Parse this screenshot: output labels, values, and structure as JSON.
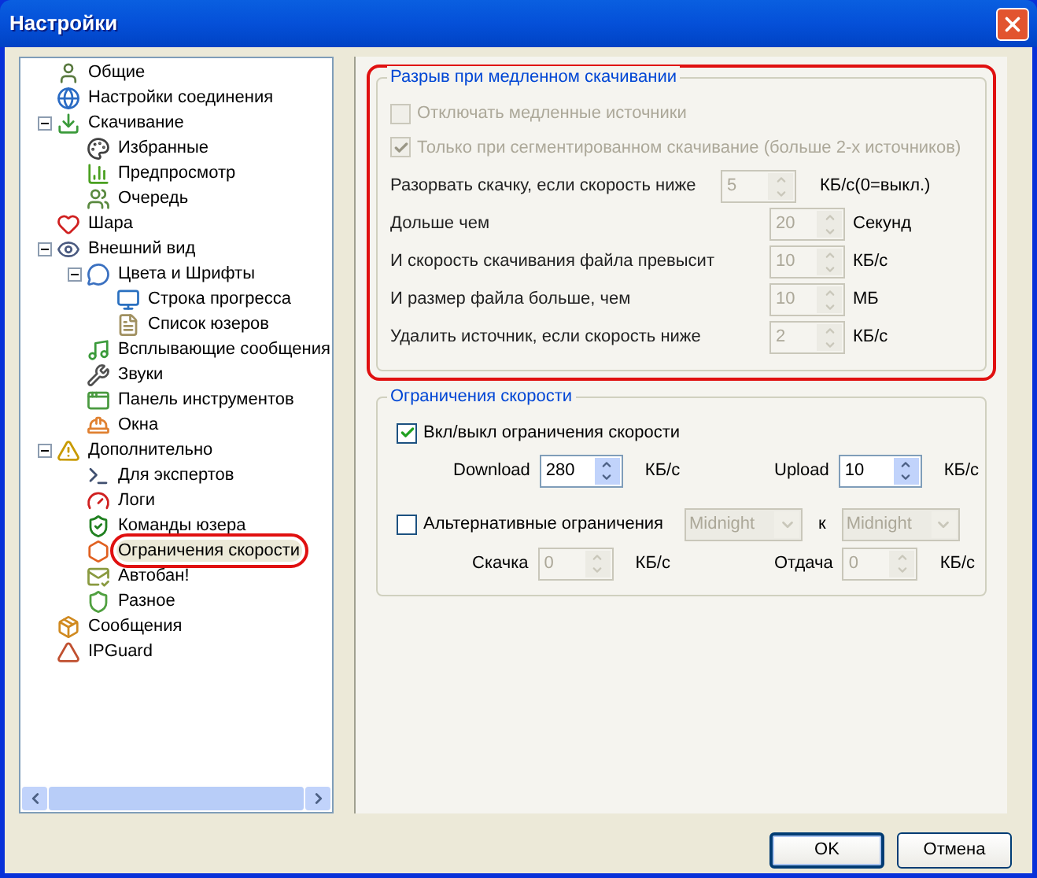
{
  "window": {
    "title": "Настройки"
  },
  "tree": {
    "items": [
      {
        "label": "Общие",
        "selected": false,
        "annotated": false
      },
      {
        "label": "Настройки соединения",
        "selected": false,
        "annotated": false
      },
      {
        "label": "Скачивание",
        "selected": false,
        "annotated": false,
        "expanded": true,
        "children": [
          {
            "label": "Избранные",
            "selected": false,
            "annotated": false
          },
          {
            "label": "Предпросмотр",
            "selected": false,
            "annotated": false
          },
          {
            "label": "Очередь",
            "selected": false,
            "annotated": false
          }
        ]
      },
      {
        "label": "Шара",
        "selected": false,
        "annotated": false
      },
      {
        "label": "Внешний вид",
        "selected": false,
        "annotated": false,
        "expanded": true,
        "children": [
          {
            "label": "Цвета и Шрифты",
            "selected": false,
            "annotated": false,
            "expanded": true,
            "children": [
              {
                "label": "Строка прогресса",
                "selected": false,
                "annotated": false
              },
              {
                "label": "Список юзеров",
                "selected": false,
                "annotated": false
              }
            ]
          },
          {
            "label": "Всплывающие сообщения",
            "selected": false,
            "annotated": false
          },
          {
            "label": "Звуки",
            "selected": false,
            "annotated": false
          },
          {
            "label": "Панель инструментов",
            "selected": false,
            "annotated": false
          },
          {
            "label": "Окна",
            "selected": false,
            "annotated": false
          }
        ]
      },
      {
        "label": "Дополнительно",
        "selected": false,
        "annotated": false,
        "expanded": true,
        "children": [
          {
            "label": "Для экспертов",
            "selected": false,
            "annotated": false
          },
          {
            "label": "Логи",
            "selected": false,
            "annotated": false
          },
          {
            "label": "Команды юзера",
            "selected": false,
            "annotated": false
          },
          {
            "label": "Ограничения скорости",
            "selected": true,
            "annotated": true
          },
          {
            "label": "Автобан!",
            "selected": false,
            "annotated": false
          },
          {
            "label": "Разное",
            "selected": false,
            "annotated": false
          }
        ]
      },
      {
        "label": "Сообщения",
        "selected": false,
        "annotated": false
      },
      {
        "label": "IPGuard",
        "selected": false,
        "annotated": false
      }
    ]
  },
  "slow_download_group": {
    "title": "Разрыв при медленном скачивании",
    "annotated": true,
    "checkboxes": [
      {
        "label": "Отключать медленные источники",
        "checked": false,
        "disabled": true
      },
      {
        "label": "Только при сегментированном скачивание (больше 2-х источников)",
        "checked": true,
        "disabled": true
      }
    ],
    "rows": [
      {
        "label": "Разорвать скачку, если скорость ниже",
        "value": "5",
        "unit": "КБ/с(0=выкл.)",
        "disabled": true
      },
      {
        "label": "Дольше чем",
        "value": "20",
        "unit": "Секунд",
        "disabled": true
      },
      {
        "label": "И скорость скачивания файла превысит",
        "value": "10",
        "unit": "КБ/с",
        "disabled": true
      },
      {
        "label": "И размер файла больше, чем",
        "value": "10",
        "unit": "МБ",
        "disabled": true
      },
      {
        "label": "Удалить источник, если скорость ниже",
        "value": "2",
        "unit": "КБ/с",
        "disabled": true
      }
    ]
  },
  "speed_limits_group": {
    "title": "Ограничения скорости",
    "enable": {
      "label": "Вкл/выкл ограничения скорости",
      "checked": true
    },
    "limits": [
      {
        "label": "Download",
        "value": "280",
        "unit": "КБ/с",
        "disabled": false
      },
      {
        "label": "Upload",
        "value": "10",
        "unit": "КБ/с",
        "disabled": false
      }
    ],
    "alternative": {
      "label": "Альтернативные ограничения",
      "checked": false,
      "from": "Midnight",
      "separator": "к",
      "to": "Midnight",
      "disabled": true
    },
    "alt_limits": [
      {
        "label": "Скачка",
        "value": "0",
        "unit": "КБ/с",
        "disabled": true
      },
      {
        "label": "Отдача",
        "value": "0",
        "unit": "КБ/с",
        "disabled": true
      }
    ]
  },
  "buttons": [
    {
      "label": "OK",
      "default": true
    },
    {
      "label": "Отмена",
      "default": false
    }
  ]
}
